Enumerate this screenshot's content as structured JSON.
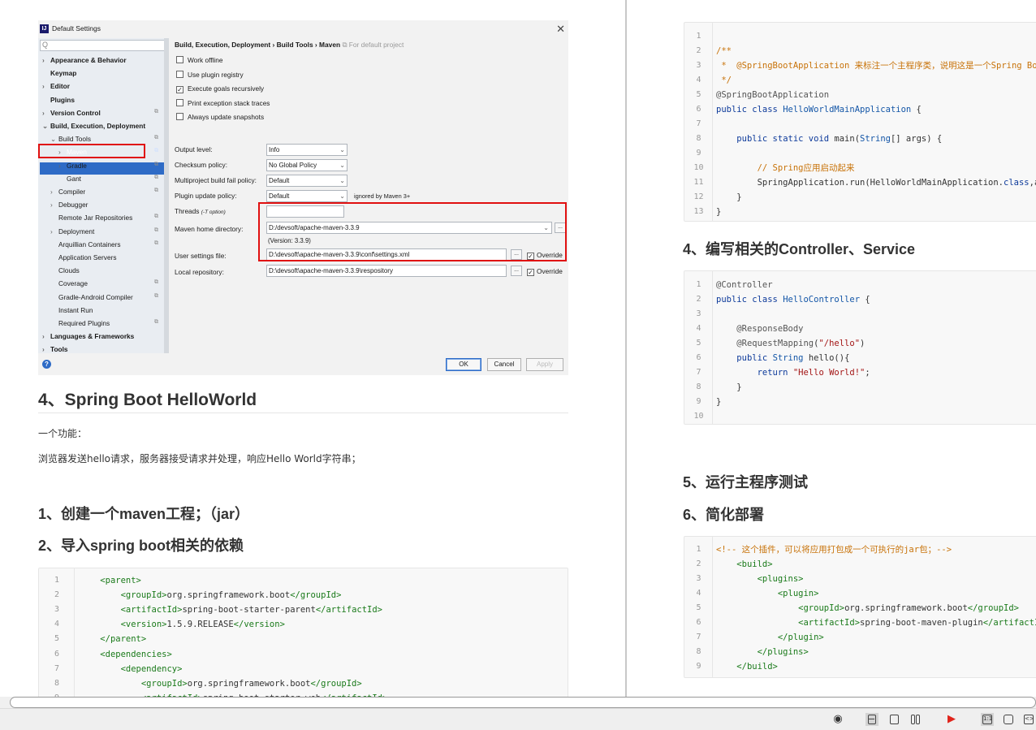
{
  "dialog": {
    "title": "Default Settings",
    "breadcrumb": "Build, Execution, Deployment › Build Tools › Maven",
    "breadcrumb_note": "For default project",
    "search_placeholder": "Q",
    "tree": [
      {
        "label": "Appearance & Behavior",
        "bold": true,
        "arrow": "›",
        "indent": 0
      },
      {
        "label": "Keymap",
        "bold": true,
        "arrow": "",
        "indent": 0
      },
      {
        "label": "Editor",
        "bold": true,
        "arrow": "›",
        "indent": 0
      },
      {
        "label": "Plugins",
        "bold": true,
        "arrow": "",
        "indent": 0
      },
      {
        "label": "Version Control",
        "bold": true,
        "arrow": "›",
        "indent": 0,
        "copy": true
      },
      {
        "label": "Build, Execution, Deployment",
        "bold": true,
        "arrow": "⌄",
        "indent": 0
      },
      {
        "label": "Build Tools",
        "bold": false,
        "arrow": "⌄",
        "indent": 1,
        "copy": true
      },
      {
        "label": "Maven",
        "bold": false,
        "arrow": "›",
        "indent": 2,
        "copy": true,
        "selected": true
      },
      {
        "label": "Gradle",
        "bold": false,
        "arrow": "›",
        "indent": 2,
        "copy": true
      },
      {
        "label": "Gant",
        "bold": false,
        "arrow": "",
        "indent": 2,
        "copy": true
      },
      {
        "label": "Compiler",
        "bold": false,
        "arrow": "›",
        "indent": 1,
        "copy": true
      },
      {
        "label": "Debugger",
        "bold": false,
        "arrow": "›",
        "indent": 1
      },
      {
        "label": "Remote Jar Repositories",
        "bold": false,
        "arrow": "",
        "indent": 1,
        "copy": true
      },
      {
        "label": "Deployment",
        "bold": false,
        "arrow": "›",
        "indent": 1,
        "copy": true
      },
      {
        "label": "Arquillian Containers",
        "bold": false,
        "arrow": "",
        "indent": 1,
        "copy": true
      },
      {
        "label": "Application Servers",
        "bold": false,
        "arrow": "",
        "indent": 1
      },
      {
        "label": "Clouds",
        "bold": false,
        "arrow": "",
        "indent": 1
      },
      {
        "label": "Coverage",
        "bold": false,
        "arrow": "",
        "indent": 1,
        "copy": true
      },
      {
        "label": "Gradle-Android Compiler",
        "bold": false,
        "arrow": "",
        "indent": 1,
        "copy": true
      },
      {
        "label": "Instant Run",
        "bold": false,
        "arrow": "",
        "indent": 1
      },
      {
        "label": "Required Plugins",
        "bold": false,
        "arrow": "",
        "indent": 1,
        "copy": true
      },
      {
        "label": "Languages & Frameworks",
        "bold": true,
        "arrow": "›",
        "indent": 0
      },
      {
        "label": "Tools",
        "bold": true,
        "arrow": "›",
        "indent": 0
      }
    ],
    "checkboxes": [
      {
        "label": "Work offline",
        "checked": false
      },
      {
        "label": "Use plugin registry",
        "checked": false
      },
      {
        "label": "Execute goals recursively",
        "checked": true
      },
      {
        "label": "Print exception stack traces",
        "checked": false
      },
      {
        "label": "Always update snapshots",
        "checked": false
      }
    ],
    "fields": {
      "output_level_label": "Output level:",
      "output_level": "Info",
      "checksum_label": "Checksum policy:",
      "checksum": "No Global Policy",
      "fail_label": "Multiproject build fail policy:",
      "fail": "Default",
      "update_label": "Plugin update policy:",
      "update": "Default",
      "update_note": "ignored by Maven 3+",
      "threads_label": "Threads",
      "threads_hint": "(-T option)",
      "home_label": "Maven home directory:",
      "home": "D:/devsoft/apache-maven-3.3.9",
      "version": "(Version: 3.3.9)",
      "settings_label": "User settings file:",
      "settings": "D:\\devsoft\\apache-maven-3.3.9\\conf\\settings.xml",
      "repo_label": "Local repository:",
      "repo": "D:\\devsoft\\apache-maven-3.3.9\\respository",
      "override": "Override",
      "browse": "..."
    },
    "buttons": {
      "ok": "OK",
      "cancel": "Cancel",
      "apply": "Apply",
      "help": "?"
    }
  },
  "article_left": {
    "h_helloworld": "4、Spring Boot HelloWorld",
    "p1": "一个功能：",
    "p2": "浏览器发送hello请求，服务器接受请求并处理，响应Hello World字符串；",
    "h_step1": "1、创建一个maven工程；（jar）",
    "h_step2": "2、导入spring boot相关的依赖",
    "code_pom": [
      {
        "n": "1",
        "html": "    <span class='tag'>&lt;parent&gt;</span>"
      },
      {
        "n": "2",
        "html": "        <span class='tag'>&lt;groupId&gt;</span>org.springframework.boot<span class='tag'>&lt;/groupId&gt;</span>"
      },
      {
        "n": "3",
        "html": "        <span class='tag'>&lt;artifactId&gt;</span>spring-boot-starter-parent<span class='tag'>&lt;/artifactId&gt;</span>"
      },
      {
        "n": "4",
        "html": "        <span class='tag'>&lt;version&gt;</span>1.5.9.RELEASE<span class='tag'>&lt;/version&gt;</span>"
      },
      {
        "n": "5",
        "html": "    <span class='tag'>&lt;/parent&gt;</span>"
      },
      {
        "n": "6",
        "html": "    <span class='tag'>&lt;dependencies&gt;</span>"
      },
      {
        "n": "7",
        "html": "        <span class='tag'>&lt;dependency&gt;</span>"
      },
      {
        "n": "8",
        "html": "            <span class='tag'>&lt;groupId&gt;</span>org.springframework.boot<span class='tag'>&lt;/groupId&gt;</span>"
      },
      {
        "n": "9",
        "html": "            <span class='tag'>&lt;artifactId&gt;</span>spring-boot-starter-web<span class='tag'>&lt;/artifactId&gt;</span>"
      }
    ]
  },
  "article_right": {
    "code_main": [
      {
        "n": "1",
        "html": ""
      },
      {
        "n": "2",
        "html": "<span class='cm'>/**</span>"
      },
      {
        "n": "3",
        "html": "<span class='cm'> *  @SpringBootApplication 来标注一个主程序类，说明这是一个Spring Boot应用</span>"
      },
      {
        "n": "4",
        "html": "<span class='cm'> */</span>"
      },
      {
        "n": "5",
        "html": "<span class='ann'>@SpringBootApplication</span>"
      },
      {
        "n": "6",
        "html": "<span class='kw'>public class</span> <span class='cls'>HelloWorldMainApplication</span> {"
      },
      {
        "n": "7",
        "html": ""
      },
      {
        "n": "8",
        "html": "    <span class='kw'>public static void</span> main(<span class='cls'>String</span>[] args) {"
      },
      {
        "n": "9",
        "html": ""
      },
      {
        "n": "10",
        "html": "        <span class='cm'>// Spring应用启动起来</span>"
      },
      {
        "n": "11",
        "html": "        SpringApplication.run(HelloWorldMainApplication.<span class='kw'>class</span>,args);"
      },
      {
        "n": "12",
        "html": "    }"
      },
      {
        "n": "13",
        "html": "}"
      }
    ],
    "h_controller": "4、编写相关的Controller、Service",
    "code_ctrl": [
      {
        "n": "1",
        "html": "<span class='ann'>@Controller</span>"
      },
      {
        "n": "2",
        "html": "<span class='kw'>public class</span> <span class='cls'>HelloController</span> {"
      },
      {
        "n": "3",
        "html": ""
      },
      {
        "n": "4",
        "html": "    <span class='ann'>@ResponseBody</span>"
      },
      {
        "n": "5",
        "html": "    <span class='ann'>@RequestMapping</span>(<span class='str'>\"/hello\"</span>)"
      },
      {
        "n": "6",
        "html": "    <span class='kw'>public</span> <span class='cls'>String</span> hello(){"
      },
      {
        "n": "7",
        "html": "        <span class='kw'>return</span> <span class='str'>\"Hello World!\"</span>;"
      },
      {
        "n": "8",
        "html": "    }"
      },
      {
        "n": "9",
        "html": "}"
      },
      {
        "n": "10",
        "html": ""
      }
    ],
    "h_run": "5、运行主程序测试",
    "h_deploy": "6、简化部署",
    "code_plugin": [
      {
        "n": "1",
        "html": "<span class='cm'>&lt;!-- 这个插件，可以将应用打包成一个可执行的jar包；--&gt;</span>"
      },
      {
        "n": "2",
        "html": "    <span class='tag'>&lt;build&gt;</span>"
      },
      {
        "n": "3",
        "html": "        <span class='tag'>&lt;plugins&gt;</span>"
      },
      {
        "n": "4",
        "html": "            <span class='tag'>&lt;plugin&gt;</span>"
      },
      {
        "n": "5",
        "html": "                <span class='tag'>&lt;groupId&gt;</span>org.springframework.boot<span class='tag'>&lt;/groupId&gt;</span>"
      },
      {
        "n": "6",
        "html": "                <span class='tag'>&lt;artifactId&gt;</span>spring-boot-maven-plugin<span class='tag'>&lt;/artifactId&gt;</span>"
      },
      {
        "n": "7",
        "html": "            <span class='tag'>&lt;/plugin&gt;</span>"
      },
      {
        "n": "8",
        "html": "        <span class='tag'>&lt;/plugins&gt;</span>"
      },
      {
        "n": "9",
        "html": "    <span class='tag'>&lt;/build&gt;</span>"
      }
    ]
  },
  "statusbar": {
    "icons": [
      "eye-icon",
      "single-page-icon",
      "continuous-icon",
      "two-page-icon",
      "present-icon",
      "actual-size-icon",
      "fit-page-icon",
      "fit-width-icon"
    ]
  }
}
